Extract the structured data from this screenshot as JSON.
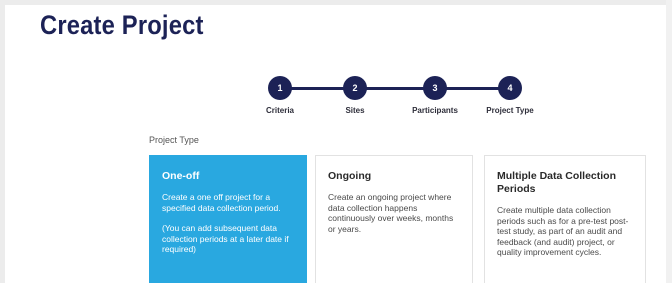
{
  "page": {
    "title": "Create Project"
  },
  "stepper": {
    "steps": [
      {
        "number": "1",
        "label": "Criteria"
      },
      {
        "number": "2",
        "label": "Sites"
      },
      {
        "number": "3",
        "label": "Participants"
      },
      {
        "number": "4",
        "label": "Project Type"
      }
    ]
  },
  "section": {
    "label": "Project Type"
  },
  "options": [
    {
      "title": "One-off",
      "description": "Create a one off project for a specified data collection period.",
      "note": "(You can add subsequent data collection periods at a later date if required)",
      "selected": true
    },
    {
      "title": "Ongoing",
      "description": "Create an ongoing project where data collection happens continuously over weeks, months or years.",
      "selected": false
    },
    {
      "title": "Multiple Data Collection Periods",
      "description": "Create multiple data collection periods such as for a pre-test post-test study, as part of an audit and feedback (and audit) project, or quality improvement cycles.",
      "selected": false
    }
  ],
  "colors": {
    "primary": "#1c2256",
    "selected": "#29a8e0"
  }
}
